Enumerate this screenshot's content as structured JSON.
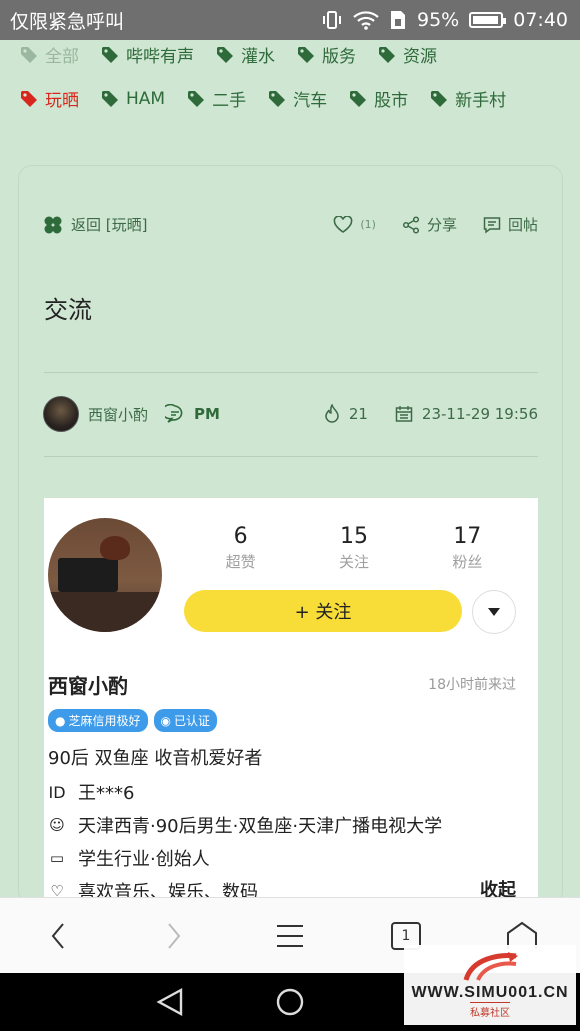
{
  "status_bar": {
    "carrier_text": "仅限紧急呼叫",
    "battery": "95%",
    "battery_level": 0.95,
    "time": "07:40"
  },
  "tags_row1": [
    {
      "label": "全部",
      "state": "dim"
    },
    {
      "label": "哔哔有声",
      "state": "normal"
    },
    {
      "label": "灌水",
      "state": "normal"
    },
    {
      "label": "版务",
      "state": "normal"
    },
    {
      "label": "资源",
      "state": "normal"
    }
  ],
  "tags_row2": [
    {
      "label": "玩晒",
      "state": "active"
    },
    {
      "label": "HAM",
      "state": "normal"
    },
    {
      "label": "二手",
      "state": "normal"
    },
    {
      "label": "汽车",
      "state": "normal"
    },
    {
      "label": "股市",
      "state": "normal"
    },
    {
      "label": "新手村",
      "state": "normal"
    }
  ],
  "post": {
    "back_label": "返回 [玩晒]",
    "like_count": "(1)",
    "share_label": "分享",
    "reply_label": "回帖",
    "title": "交流",
    "author": "西窗小酌",
    "pm_label": "PM",
    "views": "21",
    "datetime": "23-11-29 19:56"
  },
  "profile": {
    "stats": [
      {
        "value": "6",
        "label": "超赞"
      },
      {
        "value": "15",
        "label": "关注"
      },
      {
        "value": "17",
        "label": "粉丝"
      }
    ],
    "follow_label": "+ 关注",
    "name": "西窗小酌",
    "last_seen": "18小时前来过",
    "badges": [
      "芝麻信用极好",
      "已认证"
    ],
    "bio": "90后 双鱼座 收音机爱好者",
    "id_line": "王***6",
    "id_label": "ID",
    "details": "天津西青·90后男生·双鱼座·天津广播电视大学",
    "industry": "学生行业·创始人",
    "interests": "喜欢音乐、娱乐、数码",
    "collapse_label": "收起"
  },
  "browser": {
    "tab_count": "1"
  },
  "watermark": {
    "text": "WWW.SIMU001.CN",
    "sub": "私募社区"
  },
  "colors": {
    "background": "#cfe6d3",
    "tag_green": "#2f6b3a",
    "tag_active": "#d7261d",
    "follow_yellow": "#f8dc37",
    "badge_blue": "#3d9be9"
  }
}
